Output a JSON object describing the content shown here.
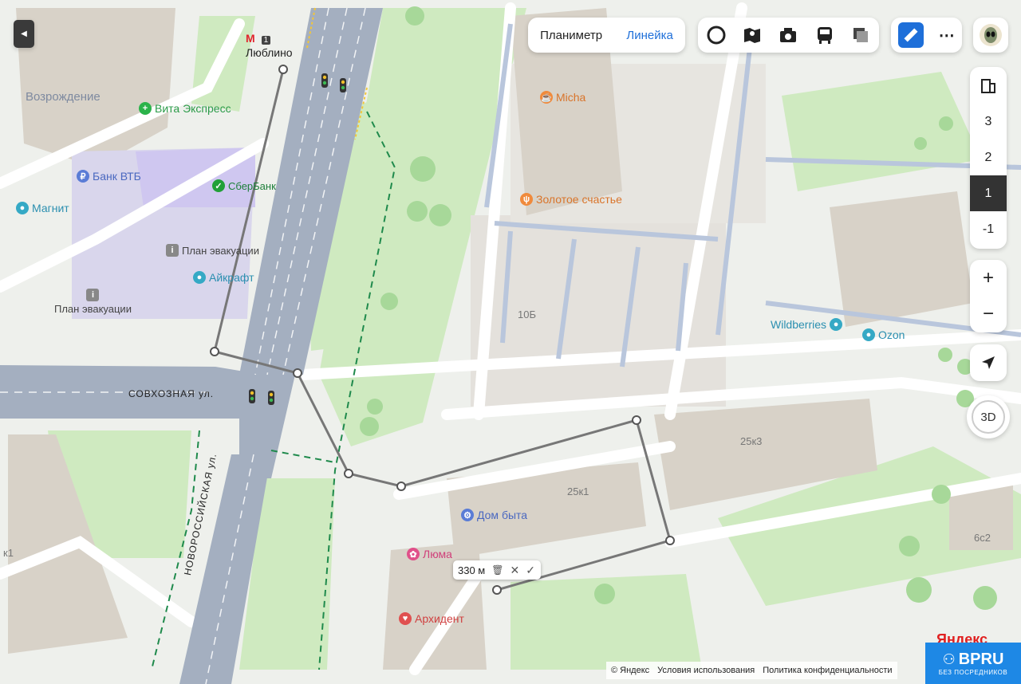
{
  "map": {
    "metro": {
      "name": "Люблино",
      "line": "1"
    },
    "streets": [
      {
        "name": "СОВХОЗНАЯ ул."
      },
      {
        "name": "НОВОРОССИЙСКАЯ ул."
      }
    ],
    "areas": [
      "Возрождение"
    ],
    "pois": [
      {
        "name": "Вита Экспресс",
        "icon": "pharmacy-icon",
        "color": "#2bb34a"
      },
      {
        "name": "Банк ВТБ",
        "icon": "bank-icon",
        "color": "#5a7cd6"
      },
      {
        "name": "Магнит",
        "icon": "shop-icon",
        "color": "#35a9c5"
      },
      {
        "name": "СберБанк",
        "icon": "sberbank-icon",
        "color": "#21a038"
      },
      {
        "name": "План эвакуации",
        "icon": "info-icon",
        "color": "#888888"
      },
      {
        "name": "Айкрафт",
        "icon": "shop-icon",
        "color": "#35a9c5"
      },
      {
        "name": "План эвакуации",
        "icon": "info-icon",
        "color": "#888888"
      },
      {
        "name": "Micha",
        "icon": "cafe-icon",
        "color": "#f08a3c"
      },
      {
        "name": "Золотое счастье",
        "icon": "restaurant-icon",
        "color": "#f08a3c"
      },
      {
        "name": "Wildberries",
        "icon": "shop-icon",
        "color": "#35a9c5"
      },
      {
        "name": "Ozon",
        "icon": "shop-icon",
        "color": "#35a9c5"
      },
      {
        "name": "Дом быта",
        "icon": "service-icon",
        "color": "#5a7cd6"
      },
      {
        "name": "Люма",
        "icon": "beauty-icon",
        "color": "#e0508a"
      },
      {
        "name": "Архидент",
        "icon": "dentist-icon",
        "color": "#e05050"
      }
    ],
    "buildings": [
      "10Б",
      "25к3",
      "25к1",
      "6с2",
      "к1"
    ]
  },
  "toolbar": {
    "tabs": [
      "Планиметр",
      "Линейка"
    ],
    "active_tab": "Линейка",
    "layer_icons": [
      "circle-layer-icon",
      "panorama-icon",
      "camera-icon",
      "bus-icon",
      "layers-icon"
    ],
    "ruler_icon": "ruler-icon",
    "more_icon": "more-icon",
    "avatar_icon": "alien-avatar-icon"
  },
  "floors": {
    "items": [
      "3",
      "2",
      "1",
      "-1"
    ],
    "active": "1"
  },
  "controls": {
    "zoom_in": "+",
    "zoom_out": "−",
    "mode_3d": "3D"
  },
  "ruler": {
    "distance": "330 м",
    "color": "#777777"
  },
  "attribution": {
    "copyright": "© Яндекс",
    "terms": "Условия использования",
    "privacy": "Политика конфиденциальности"
  },
  "watermark": {
    "title": "BPRU",
    "subtitle": "БЕЗ ПОСРЕДНИКОВ",
    "color": "#1e88e5"
  },
  "yandex_corner": "Яндекс"
}
